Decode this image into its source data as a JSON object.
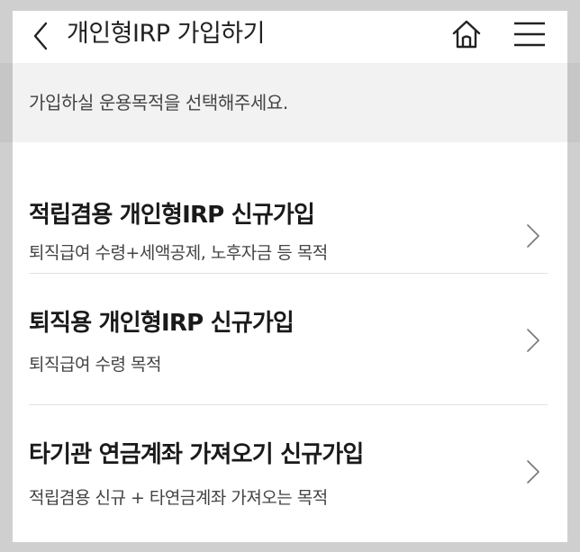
{
  "header": {
    "title": "개인형IRP 가입하기",
    "back_icon": "chevron-left-icon",
    "home_icon": "home-icon",
    "menu_icon": "hamburger-menu-icon"
  },
  "subheader": {
    "text": "가입하실 운용목적을 선택해주세요."
  },
  "options": [
    {
      "title": "적립겸용 개인형IRP 신규가입",
      "desc": "퇴직급여 수령+세액공제, 노후자금 등 목적"
    },
    {
      "title": "퇴직용 개인형IRP 신규가입",
      "desc": "퇴직급여 수령 목적"
    },
    {
      "title": "타기관 연금계좌 가져오기 신규가입",
      "desc": "적립겸용 신규 + 타연금계좌 가져오는 목적"
    }
  ],
  "colors": {
    "text_primary": "#1a1a1a",
    "subheader_bg": "#f2f2f2",
    "divider": "#e2e2e2"
  }
}
